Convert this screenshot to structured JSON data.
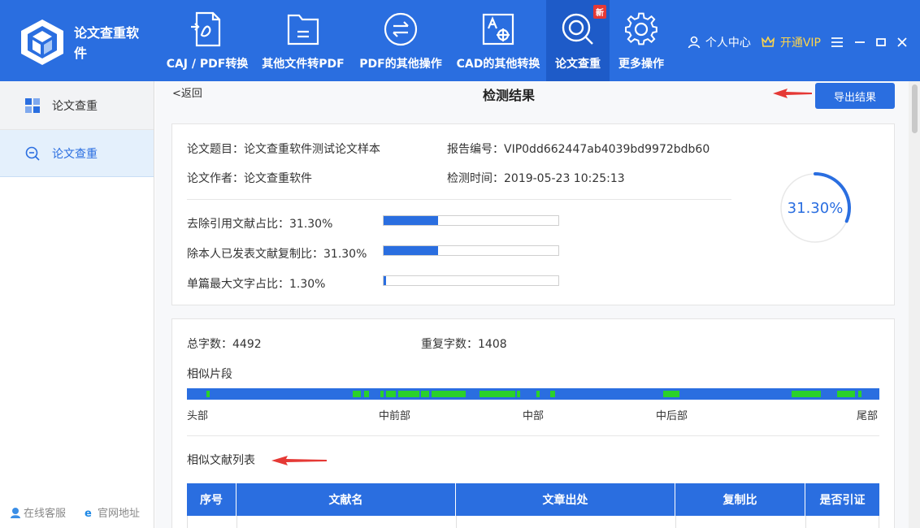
{
  "app": {
    "title": "论文查重软件"
  },
  "nav": [
    {
      "label": "CAJ / PDF转换",
      "icon": "pdf-convert-icon"
    },
    {
      "label": "其他文件转PDF",
      "icon": "folder-icon"
    },
    {
      "label": "PDF的其他操作",
      "icon": "arrows-swap-icon"
    },
    {
      "label": "CAD的其他转换",
      "icon": "cad-icon"
    },
    {
      "label": "论文查重",
      "icon": "search-check-icon",
      "badge": "新",
      "active": true
    },
    {
      "label": "更多操作",
      "icon": "gear-icon"
    }
  ],
  "header_right": {
    "user_center": "个人中心",
    "vip": "开通VIP"
  },
  "sidebar": {
    "items": [
      {
        "label": "论文查重",
        "icon": "grid-icon"
      },
      {
        "label": "论文查重",
        "icon": "search-icon"
      }
    ],
    "footer": {
      "service": "在线客服",
      "website": "官网地址"
    }
  },
  "main": {
    "back": "<返回",
    "title": "检测结果",
    "export": "导出结果",
    "report": {
      "title_label": "论文题目：论文查重软件测试论文样本",
      "author_label": "论文作者：论文查重软件",
      "report_no": "报告编号：VIP0dd662447ab4039bd9972bdb60",
      "check_time": "检测时间：2019-05-23 10:25:13"
    },
    "stats": [
      {
        "label": "去除引用文献占比：31.30%",
        "value": 31.3
      },
      {
        "label": "除本人已发表文献复制比：31.30%",
        "value": 31.3
      },
      {
        "label": "单篇最大文字占比：1.30%",
        "value": 1.3
      }
    ],
    "ring": {
      "text": "31.30%",
      "value": 31.3
    },
    "summary": {
      "total_words": "总字数：4492",
      "dup_words": "重复字数：1408"
    },
    "similar_segments": {
      "title": "相似片段",
      "positions": [
        "头部",
        "中前部",
        "中部",
        "中后部",
        "尾部"
      ]
    },
    "similar_list": {
      "title": "相似文献列表",
      "columns": [
        "序号",
        "文献名",
        "文章出处",
        "复制比",
        "是否引证"
      ]
    }
  },
  "colors": {
    "primary": "#2a6ee0",
    "segment": "#2ad12a",
    "arrow": "#e53935"
  }
}
